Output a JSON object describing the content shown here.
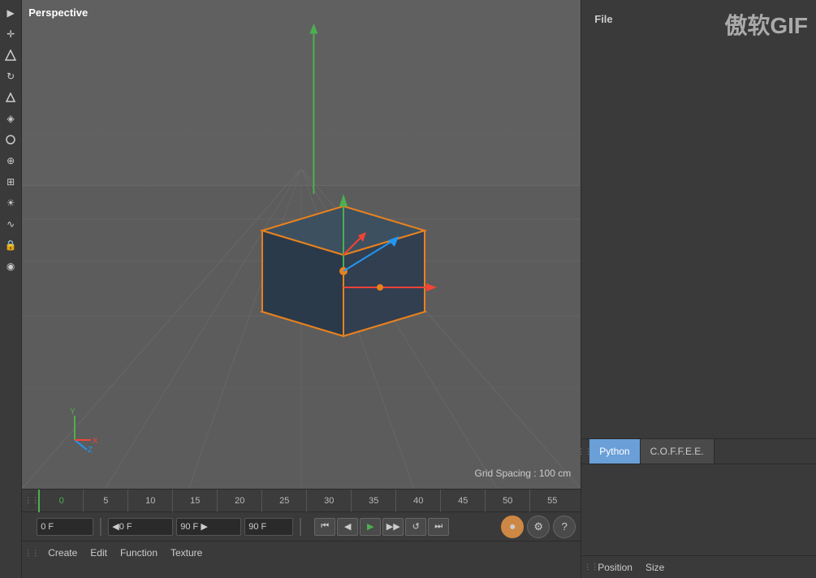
{
  "viewport": {
    "perspective_label": "Perspective",
    "grid_spacing": "Grid Spacing : 100 cm"
  },
  "left_toolbar": {
    "icons": [
      {
        "name": "select-icon",
        "symbol": "▶",
        "active": false
      },
      {
        "name": "move-icon",
        "symbol": "✛",
        "active": false
      },
      {
        "name": "scale-icon",
        "symbol": "⬡",
        "active": false
      },
      {
        "name": "rotate-icon",
        "symbol": "↻",
        "active": false
      },
      {
        "name": "polygon-icon",
        "symbol": "△",
        "active": false
      },
      {
        "name": "paint-icon",
        "symbol": "◈",
        "active": false
      },
      {
        "name": "knife-icon",
        "symbol": "⌀",
        "active": false
      },
      {
        "name": "magnet-icon",
        "symbol": "⊕",
        "active": false
      },
      {
        "name": "camera-icon",
        "symbol": "⊞",
        "active": false
      },
      {
        "name": "light-icon",
        "symbol": "☀",
        "active": false
      },
      {
        "name": "curve-icon",
        "symbol": "∿",
        "active": false
      },
      {
        "name": "lock-icon",
        "symbol": "🔒",
        "active": false
      },
      {
        "name": "material-icon",
        "symbol": "◉",
        "active": false
      }
    ]
  },
  "timeline": {
    "ticks": [
      {
        "label": "0",
        "active": true
      },
      {
        "label": "5",
        "active": false
      },
      {
        "label": "10",
        "active": false
      },
      {
        "label": "15",
        "active": false
      },
      {
        "label": "20",
        "active": false
      },
      {
        "label": "25",
        "active": false
      },
      {
        "label": "30",
        "active": false
      },
      {
        "label": "35",
        "active": false
      },
      {
        "label": "40",
        "active": false
      },
      {
        "label": "45",
        "active": false
      },
      {
        "label": "50",
        "active": false
      },
      {
        "label": "55",
        "active": false
      }
    ],
    "frame_start": "0 F",
    "frame_current": "◀0 F",
    "frame_end_input": "90 F ▶",
    "frame_end": "90 F"
  },
  "playback": {
    "rewind_label": "⏮",
    "prev_label": "◀",
    "play_label": "▶",
    "fast_forward_label": "▶▶",
    "loop_label": "↺",
    "end_label": "⏭",
    "record_label": "⏺",
    "auto_label": "⚙",
    "help_label": "?"
  },
  "menu_bottom": {
    "items": [
      {
        "label": "Create",
        "active": false
      },
      {
        "label": "Edit",
        "active": false
      },
      {
        "label": "Function",
        "active": false
      },
      {
        "label": "Texture",
        "active": false
      }
    ]
  },
  "right_panel": {
    "file_menu": "File",
    "watermark": "傲软GIF",
    "tabs": [
      {
        "label": "Python",
        "active": true
      },
      {
        "label": "C.O.F.F.E.E.",
        "active": false
      }
    ]
  },
  "bottom_bar": {
    "position_label": "Position",
    "size_label": "Size"
  }
}
